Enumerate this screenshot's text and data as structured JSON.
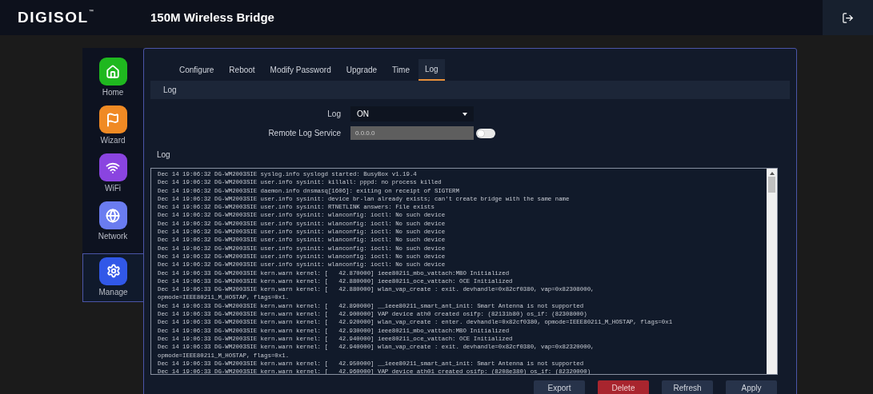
{
  "header": {
    "logo": "DIGISOL",
    "logo_mark": "™",
    "title": "150M Wireless Bridge"
  },
  "sidebar": {
    "items": [
      {
        "label": "Home",
        "kind": "home",
        "selected": false
      },
      {
        "label": "Wizard",
        "kind": "wizard",
        "selected": false
      },
      {
        "label": "WiFi",
        "kind": "wifi",
        "selected": false
      },
      {
        "label": "Network",
        "kind": "network",
        "selected": false
      },
      {
        "label": "Manage",
        "kind": "manage",
        "selected": true
      }
    ]
  },
  "tabs": [
    {
      "label": "Configure",
      "selected": false
    },
    {
      "label": "Reboot",
      "selected": false
    },
    {
      "label": "Modify Password",
      "selected": false
    },
    {
      "label": "Upgrade",
      "selected": false
    },
    {
      "label": "Time",
      "selected": false
    },
    {
      "label": "Log",
      "selected": true
    }
  ],
  "section_title": "Log",
  "form": {
    "log": {
      "label": "Log",
      "value": "ON"
    },
    "remote": {
      "label": "Remote Log Service",
      "placeholder": "0.0.0.0",
      "disabled": true,
      "on": false
    }
  },
  "log_title": "Log",
  "log_lines": [
    "Dec 14 19:06:32 DG-WM2003SIE syslog.info syslogd started: BusyBox v1.19.4",
    "Dec 14 19:06:32 DG-WM2003SIE user.info sysinit: killall: pppd: no process killed",
    "Dec 14 19:06:32 DG-WM2003SIE daemon.info dnsmasq[1606]: exiting on receipt of SIGTERM",
    "Dec 14 19:06:32 DG-WM2003SIE user.info sysinit: device br-lan already exists; can't create bridge with the same name",
    "Dec 14 19:06:32 DG-WM2003SIE user.info sysinit: RTNETLINK answers: File exists",
    "Dec 14 19:06:32 DG-WM2003SIE user.info sysinit: wlanconfig: ioctl: No such device",
    "Dec 14 19:06:32 DG-WM2003SIE user.info sysinit: wlanconfig: ioctl: No such device",
    "Dec 14 19:06:32 DG-WM2003SIE user.info sysinit: wlanconfig: ioctl: No such device",
    "Dec 14 19:06:32 DG-WM2003SIE user.info sysinit: wlanconfig: ioctl: No such device",
    "Dec 14 19:06:32 DG-WM2003SIE user.info sysinit: wlanconfig: ioctl: No such device",
    "Dec 14 19:06:32 DG-WM2003SIE user.info sysinit: wlanconfig: ioctl: No such device",
    "Dec 14 19:06:32 DG-WM2003SIE user.info sysinit: wlanconfig: ioctl: No such device",
    "Dec 14 19:06:33 DG-WM2003SIE kern.warn kernel: [   42.870000] ieee80211_mbo_vattach:MBO Initialized",
    "Dec 14 19:06:33 DG-WM2003SIE kern.warn kernel: [   42.880000] ieee80211_oce_vattach: OCE Initialized",
    "Dec 14 19:06:33 DG-WM2003SIE kern.warn kernel: [   42.880000] wlan_vap_create : exit. devhandle=0x82cf0380, vap=0x82308000,",
    "opmode=IEEE80211_M_HOSTAP, flags=0x1.",
    "Dec 14 19:06:33 DG-WM2003SIE kern.warn kernel: [   42.890000] __ieee80211_smart_ant_init: Smart Antenna is not supported",
    "Dec 14 19:06:33 DG-WM2003SIE kern.warn kernel: [   42.900000] VAP device ath0 created osifp: (82131b80) os_if: (82308000)",
    "Dec 14 19:06:33 DG-WM2003SIE kern.warn kernel: [   42.920000] wlan_vap_create : enter. devhandle=0x82cf0380, opmode=IEEE80211_M_HOSTAP, flags=0x1",
    "Dec 14 19:06:33 DG-WM2003SIE kern.warn kernel: [   42.930000] ieee80211_mbo_vattach:MBO Initialized",
    "Dec 14 19:06:33 DG-WM2003SIE kern.warn kernel: [   42.940000] ieee80211_oce_vattach: OCE Initialized",
    "Dec 14 19:06:33 DG-WM2003SIE kern.warn kernel: [   42.940000] wlan_vap_create : exit. devhandle=0x82cf0380, vap=0x82320000,",
    "opmode=IEEE80211_M_HOSTAP, flags=0x1.",
    "Dec 14 19:06:33 DG-WM2003SIE kern.warn kernel: [   42.950000] __ieee80211_smart_ant_init: Smart Antenna is not supported",
    "Dec 14 19:06:33 DG-WM2003SIE kern.warn kernel: [   42.960000] VAP device ath01 created osifp: (8208e380) os_if: (82320000)"
  ],
  "buttons": [
    {
      "label": "Export",
      "kind": "normal"
    },
    {
      "label": "Delete",
      "kind": "danger"
    },
    {
      "label": "Refresh",
      "kind": "normal"
    },
    {
      "label": "Apply",
      "kind": "normal"
    }
  ]
}
